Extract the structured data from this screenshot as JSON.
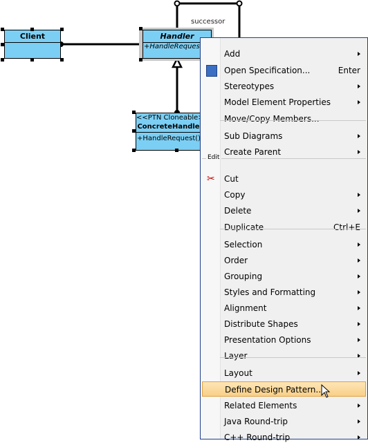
{
  "diagram": {
    "client": {
      "name": "Client"
    },
    "handler": {
      "name": "Handler",
      "operation": "+HandleRequest()"
    },
    "concrete": {
      "stereotype": "<<PTN Cloneable>>",
      "name": "ConcreteHandler",
      "operation": "+HandleRequest()"
    },
    "association_label": "successor"
  },
  "menu": {
    "section_edit": "Edit",
    "items": [
      {
        "label": "Add",
        "submenu": true
      },
      {
        "label": "Open Specification...",
        "shortcut": "Enter",
        "icon": "specification-icon"
      },
      {
        "label": "Stereotypes",
        "submenu": true
      },
      {
        "label": "Model Element Properties",
        "submenu": true
      },
      {
        "label": "Move/Copy Members..."
      },
      {
        "label": "Sub Diagrams",
        "submenu": true
      },
      {
        "label": "Create Parent",
        "submenu": true
      },
      {
        "label": "Cut",
        "icon": "scissors-icon"
      },
      {
        "label": "Copy",
        "submenu": true
      },
      {
        "label": "Delete",
        "submenu": true
      },
      {
        "label": "Duplicate",
        "shortcut": "Ctrl+E"
      },
      {
        "label": "Selection",
        "submenu": true
      },
      {
        "label": "Order",
        "submenu": true
      },
      {
        "label": "Grouping",
        "submenu": true
      },
      {
        "label": "Styles and Formatting",
        "submenu": true
      },
      {
        "label": "Alignment",
        "submenu": true
      },
      {
        "label": "Distribute Shapes",
        "submenu": true
      },
      {
        "label": "Presentation Options",
        "submenu": true
      },
      {
        "label": "Layer",
        "submenu": true
      },
      {
        "label": "Layout",
        "submenu": true
      },
      {
        "label": "Define Design Pattern...",
        "highlighted": true
      },
      {
        "label": "Related Elements",
        "submenu": true
      },
      {
        "label": "Java Round-trip",
        "submenu": true
      },
      {
        "label": "C++ Round-trip",
        "submenu": true
      }
    ]
  }
}
